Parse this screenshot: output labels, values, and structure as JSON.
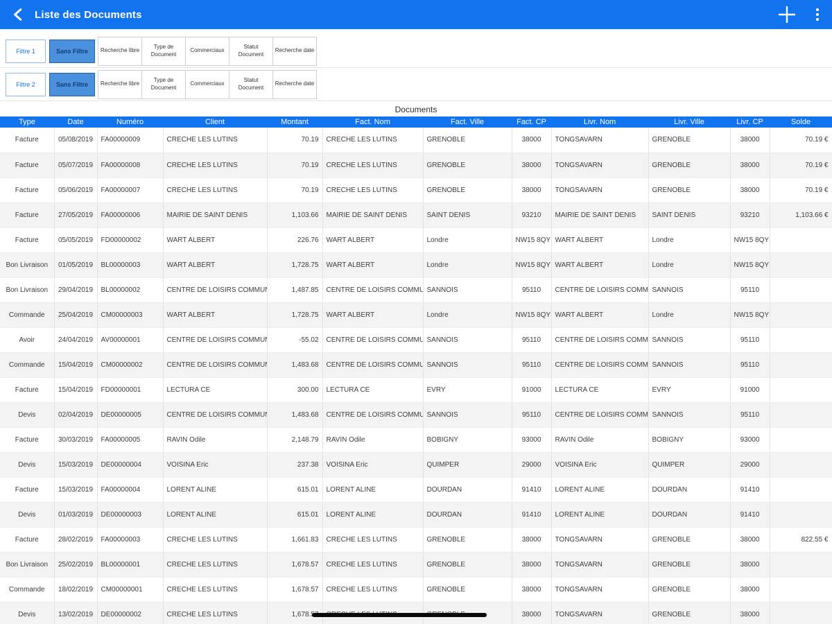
{
  "app": {
    "title": "Liste des Documents",
    "icons": {
      "back": "chevron-left",
      "add": "plus",
      "menu": "vertical-ellipsis"
    }
  },
  "colors": {
    "primary": "#1273ee",
    "selected_filter_bg": "#4a90dc"
  },
  "filters": {
    "rows": [
      {
        "label": "Filtre 1",
        "selected": "Sans Filtre",
        "options": [
          "Recherche libre",
          "Type de Document",
          "Commerciaux",
          "Statut Document",
          "Recherche date"
        ]
      },
      {
        "label": "Filtre 2",
        "selected": "Sans Filtre",
        "options": [
          "Recherche libre",
          "Type de Document",
          "Commerciaux",
          "Statut Document",
          "Recherche date"
        ]
      }
    ]
  },
  "table": {
    "caption": "Documents",
    "columns": [
      "Type",
      "Date",
      "Numéro",
      "Client",
      "Montant",
      "Fact. Nom",
      "Fact. Ville",
      "Fact. CP",
      "Livr. Nom",
      "Livr. Ville",
      "Livr. CP",
      "Solde"
    ],
    "rows": [
      [
        "Facture",
        "05/08/2019",
        "FA00000009",
        "CRECHE LES LUTINS",
        "70.19",
        "CRECHE LES LUTINS",
        "GRENOBLE",
        "38000",
        "TONGSAVARN",
        "GRENOBLE",
        "38000",
        "70.19 €"
      ],
      [
        "Facture",
        "05/07/2019",
        "FA00000008",
        "CRECHE LES LUTINS",
        "70.19",
        "CRECHE LES LUTINS",
        "GRENOBLE",
        "38000",
        "TONGSAVARN",
        "GRENOBLE",
        "38000",
        "70.19 €"
      ],
      [
        "Facture",
        "05/06/2019",
        "FA00000007",
        "CRECHE LES LUTINS",
        "70.19",
        "CRECHE LES LUTINS",
        "GRENOBLE",
        "38000",
        "TONGSAVARN",
        "GRENOBLE",
        "38000",
        "70.19 €"
      ],
      [
        "Facture",
        "27/05/2019",
        "FA00000006",
        "MAIRIE DE SAINT DENIS",
        "1,103.66",
        "MAIRIE DE SAINT DENIS",
        "SAINT DENIS",
        "93210",
        "MAIRIE DE SAINT DENIS",
        "SAINT DENIS",
        "93210",
        "1,103.66 €"
      ],
      [
        "Facture",
        "05/05/2019",
        "FD00000002",
        "WART ALBERT",
        "226.76",
        "WART ALBERT",
        "Londre",
        "NW15 8QY",
        "WART ALBERT",
        "Londre",
        "NW15 8QY",
        ""
      ],
      [
        "Bon Livraison",
        "01/05/2019",
        "BL00000003",
        "WART ALBERT",
        "1,728.75",
        "WART ALBERT",
        "Londre",
        "NW15 8QY",
        "WART ALBERT",
        "Londre",
        "NW15 8QY",
        ""
      ],
      [
        "Bon Livraison",
        "29/04/2019",
        "BL00000002",
        "CENTRE DE LOISIRS COMMUNAL",
        "1,487.85",
        "CENTRE DE LOISIRS COMMUNAL",
        "SANNOIS",
        "95110",
        "CENTRE DE LOISIRS COMMUNAL",
        "SANNOIS",
        "95110",
        ""
      ],
      [
        "Commande",
        "25/04/2019",
        "CM00000003",
        "WART ALBERT",
        "1,728.75",
        "WART ALBERT",
        "Londre",
        "NW15 8QY",
        "WART ALBERT",
        "Londre",
        "NW15 8QY",
        ""
      ],
      [
        "Avoir",
        "24/04/2019",
        "AV00000001",
        "CENTRE DE LOISIRS COMMUNAL",
        "-55.02",
        "CENTRE DE LOISIRS COMMUNAL",
        "SANNOIS",
        "95110",
        "CENTRE DE LOISIRS COMMUNAL",
        "SANNOIS",
        "95110",
        ""
      ],
      [
        "Commande",
        "15/04/2019",
        "CM00000002",
        "CENTRE DE LOISIRS COMMUNAL",
        "1,483.68",
        "CENTRE DE LOISIRS COMMUNAL",
        "SANNOIS",
        "95110",
        "CENTRE DE LOISIRS COMMUNAL",
        "SANNOIS",
        "95110",
        ""
      ],
      [
        "Facture",
        "15/04/2019",
        "FD00000001",
        "LECTURA CE",
        "300.00",
        "LECTURA CE",
        "EVRY",
        "91000",
        "LECTURA CE",
        "EVRY",
        "91000",
        ""
      ],
      [
        "Devis",
        "02/04/2019",
        "DE00000005",
        "CENTRE DE LOISIRS COMMUNAL",
        "1,483.68",
        "CENTRE DE LOISIRS COMMUNAL",
        "SANNOIS",
        "95110",
        "CENTRE DE LOISIRS COMMUNAL",
        "SANNOIS",
        "95110",
        ""
      ],
      [
        "Facture",
        "30/03/2019",
        "FA00000005",
        "RAVIN Odile",
        "2,148.79",
        "RAVIN Odile",
        "BOBIGNY",
        "93000",
        "RAVIN Odile",
        "BOBIGNY",
        "93000",
        ""
      ],
      [
        "Devis",
        "15/03/2019",
        "DE00000004",
        "VOISINA Eric",
        "237.38",
        "VOISINA Eric",
        "QUIMPER",
        "29000",
        "VOISINA Eric",
        "QUIMPER",
        "29000",
        ""
      ],
      [
        "Facture",
        "15/03/2019",
        "FA00000004",
        "LORENT ALINE",
        "615.01",
        "LORENT ALINE",
        "DOURDAN",
        "91410",
        "LORENT ALINE",
        "DOURDAN",
        "91410",
        ""
      ],
      [
        "Devis",
        "01/03/2019",
        "DE00000003",
        "LORENT ALINE",
        "615.01",
        "LORENT ALINE",
        "DOURDAN",
        "91410",
        "LORENT ALINE",
        "DOURDAN",
        "91410",
        ""
      ],
      [
        "Facture",
        "28/02/2019",
        "FA00000003",
        "CRECHE LES LUTINS",
        "1,661.83",
        "CRECHE LES LUTINS",
        "GRENOBLE",
        "38000",
        "TONGSAVARN",
        "GRENOBLE",
        "38000",
        "822.55 €"
      ],
      [
        "Bon Livraison",
        "25/02/2019",
        "BL00000001",
        "CRECHE LES LUTINS",
        "1,678.57",
        "CRECHE LES LUTINS",
        "GRENOBLE",
        "38000",
        "TONGSAVARN",
        "GRENOBLE",
        "38000",
        ""
      ],
      [
        "Commande",
        "18/02/2019",
        "CM00000001",
        "CRECHE LES LUTINS",
        "1,678.57",
        "CRECHE LES LUTINS",
        "GRENOBLE",
        "38000",
        "TONGSAVARN",
        "GRENOBLE",
        "38000",
        ""
      ],
      [
        "Devis",
        "13/02/2019",
        "DE00000002",
        "CRECHE LES LUTINS",
        "1,678.57",
        "CRECHE LES LUTINS",
        "GRENOBLE",
        "38000",
        "TONGSAVARN",
        "GRENOBLE",
        "38000",
        ""
      ]
    ]
  }
}
